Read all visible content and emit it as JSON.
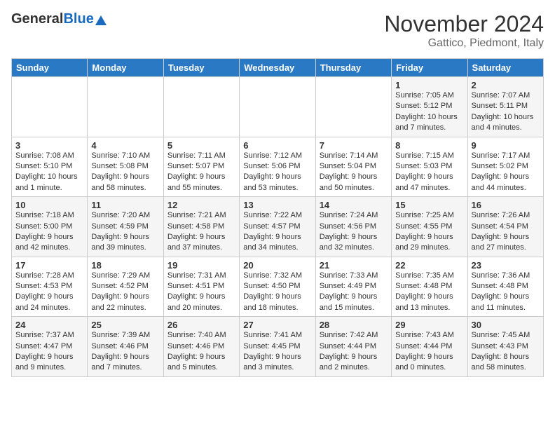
{
  "header": {
    "logo_general": "General",
    "logo_blue": "Blue",
    "month": "November 2024",
    "location": "Gattico, Piedmont, Italy"
  },
  "weekdays": [
    "Sunday",
    "Monday",
    "Tuesday",
    "Wednesday",
    "Thursday",
    "Friday",
    "Saturday"
  ],
  "weeks": [
    [
      {
        "day": "",
        "info": ""
      },
      {
        "day": "",
        "info": ""
      },
      {
        "day": "",
        "info": ""
      },
      {
        "day": "",
        "info": ""
      },
      {
        "day": "",
        "info": ""
      },
      {
        "day": "1",
        "info": "Sunrise: 7:05 AM\nSunset: 5:12 PM\nDaylight: 10 hours\nand 7 minutes."
      },
      {
        "day": "2",
        "info": "Sunrise: 7:07 AM\nSunset: 5:11 PM\nDaylight: 10 hours\nand 4 minutes."
      }
    ],
    [
      {
        "day": "3",
        "info": "Sunrise: 7:08 AM\nSunset: 5:10 PM\nDaylight: 10 hours\nand 1 minute."
      },
      {
        "day": "4",
        "info": "Sunrise: 7:10 AM\nSunset: 5:08 PM\nDaylight: 9 hours\nand 58 minutes."
      },
      {
        "day": "5",
        "info": "Sunrise: 7:11 AM\nSunset: 5:07 PM\nDaylight: 9 hours\nand 55 minutes."
      },
      {
        "day": "6",
        "info": "Sunrise: 7:12 AM\nSunset: 5:06 PM\nDaylight: 9 hours\nand 53 minutes."
      },
      {
        "day": "7",
        "info": "Sunrise: 7:14 AM\nSunset: 5:04 PM\nDaylight: 9 hours\nand 50 minutes."
      },
      {
        "day": "8",
        "info": "Sunrise: 7:15 AM\nSunset: 5:03 PM\nDaylight: 9 hours\nand 47 minutes."
      },
      {
        "day": "9",
        "info": "Sunrise: 7:17 AM\nSunset: 5:02 PM\nDaylight: 9 hours\nand 44 minutes."
      }
    ],
    [
      {
        "day": "10",
        "info": "Sunrise: 7:18 AM\nSunset: 5:00 PM\nDaylight: 9 hours\nand 42 minutes."
      },
      {
        "day": "11",
        "info": "Sunrise: 7:20 AM\nSunset: 4:59 PM\nDaylight: 9 hours\nand 39 minutes."
      },
      {
        "day": "12",
        "info": "Sunrise: 7:21 AM\nSunset: 4:58 PM\nDaylight: 9 hours\nand 37 minutes."
      },
      {
        "day": "13",
        "info": "Sunrise: 7:22 AM\nSunset: 4:57 PM\nDaylight: 9 hours\nand 34 minutes."
      },
      {
        "day": "14",
        "info": "Sunrise: 7:24 AM\nSunset: 4:56 PM\nDaylight: 9 hours\nand 32 minutes."
      },
      {
        "day": "15",
        "info": "Sunrise: 7:25 AM\nSunset: 4:55 PM\nDaylight: 9 hours\nand 29 minutes."
      },
      {
        "day": "16",
        "info": "Sunrise: 7:26 AM\nSunset: 4:54 PM\nDaylight: 9 hours\nand 27 minutes."
      }
    ],
    [
      {
        "day": "17",
        "info": "Sunrise: 7:28 AM\nSunset: 4:53 PM\nDaylight: 9 hours\nand 24 minutes."
      },
      {
        "day": "18",
        "info": "Sunrise: 7:29 AM\nSunset: 4:52 PM\nDaylight: 9 hours\nand 22 minutes."
      },
      {
        "day": "19",
        "info": "Sunrise: 7:31 AM\nSunset: 4:51 PM\nDaylight: 9 hours\nand 20 minutes."
      },
      {
        "day": "20",
        "info": "Sunrise: 7:32 AM\nSunset: 4:50 PM\nDaylight: 9 hours\nand 18 minutes."
      },
      {
        "day": "21",
        "info": "Sunrise: 7:33 AM\nSunset: 4:49 PM\nDaylight: 9 hours\nand 15 minutes."
      },
      {
        "day": "22",
        "info": "Sunrise: 7:35 AM\nSunset: 4:48 PM\nDaylight: 9 hours\nand 13 minutes."
      },
      {
        "day": "23",
        "info": "Sunrise: 7:36 AM\nSunset: 4:48 PM\nDaylight: 9 hours\nand 11 minutes."
      }
    ],
    [
      {
        "day": "24",
        "info": "Sunrise: 7:37 AM\nSunset: 4:47 PM\nDaylight: 9 hours\nand 9 minutes."
      },
      {
        "day": "25",
        "info": "Sunrise: 7:39 AM\nSunset: 4:46 PM\nDaylight: 9 hours\nand 7 minutes."
      },
      {
        "day": "26",
        "info": "Sunrise: 7:40 AM\nSunset: 4:46 PM\nDaylight: 9 hours\nand 5 minutes."
      },
      {
        "day": "27",
        "info": "Sunrise: 7:41 AM\nSunset: 4:45 PM\nDaylight: 9 hours\nand 3 minutes."
      },
      {
        "day": "28",
        "info": "Sunrise: 7:42 AM\nSunset: 4:44 PM\nDaylight: 9 hours\nand 2 minutes."
      },
      {
        "day": "29",
        "info": "Sunrise: 7:43 AM\nSunset: 4:44 PM\nDaylight: 9 hours\nand 0 minutes."
      },
      {
        "day": "30",
        "info": "Sunrise: 7:45 AM\nSunset: 4:43 PM\nDaylight: 8 hours\nand 58 minutes."
      }
    ]
  ]
}
